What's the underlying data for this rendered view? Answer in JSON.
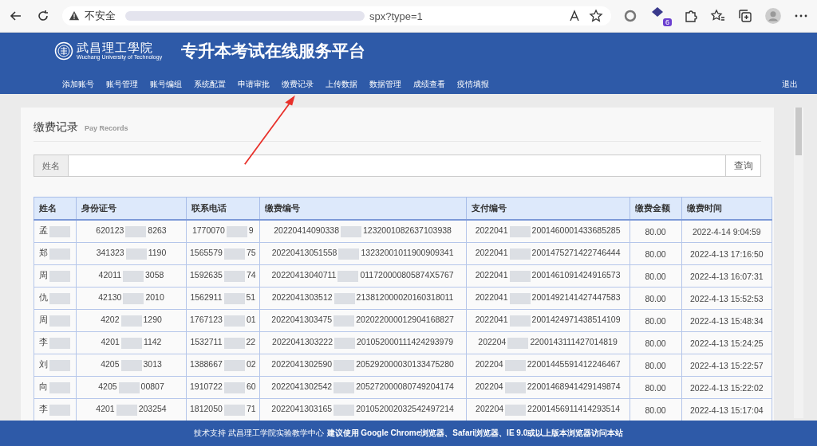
{
  "browser": {
    "security_label": "不安全",
    "url_visible": "spx?type=1",
    "extension_badge": "6"
  },
  "header": {
    "logo_name": "武昌理工學院",
    "logo_english": "Wuchang University of Technology",
    "title": "专升本考试在线服务平台"
  },
  "nav": [
    {
      "label": "添加账号"
    },
    {
      "label": "账号管理"
    },
    {
      "label": "账号编组"
    },
    {
      "label": "系统配置"
    },
    {
      "label": "申请审批"
    },
    {
      "label": "缴费记录"
    },
    {
      "label": "上传数据"
    },
    {
      "label": "数据管理"
    },
    {
      "label": "成绩查看"
    },
    {
      "label": "疫情填报"
    }
  ],
  "logout": "退出",
  "page": {
    "title": "缴费记录",
    "subtitle": "Pay Records"
  },
  "search": {
    "label": "姓名",
    "button": "查询"
  },
  "table": {
    "columns": [
      "姓名",
      "身份证号",
      "联系电话",
      "缴费编号",
      "支付编号",
      "缴费金额",
      "缴费时间"
    ],
    "rows": [
      [
        [
          "孟"
        ],
        [
          "620123",
          "8263"
        ],
        [
          "1770070",
          "9"
        ],
        [
          "20220414090338",
          "1232001082637103938"
        ],
        [
          "2022041",
          "2001460001433685285"
        ],
        "80.00",
        "2022-4-14 9:04:59"
      ],
      [
        [
          "郑"
        ],
        [
          "341323",
          "1190"
        ],
        [
          "1565579",
          "75"
        ],
        [
          "20220413051558",
          "13232001011900909341"
        ],
        [
          "2022041",
          "2001475271422746444"
        ],
        "80.00",
        "2022-4-13 17:16:50"
      ],
      [
        [
          "周"
        ],
        [
          "42011",
          "3058"
        ],
        [
          "1592635",
          "74"
        ],
        [
          "20220413040711",
          "011720000805874X5767"
        ],
        [
          "2022041",
          "2001461091424916573"
        ],
        "80.00",
        "2022-4-13 16:07:31"
      ],
      [
        [
          "仇"
        ],
        [
          "42130",
          "2010"
        ],
        [
          "1562911",
          "51"
        ],
        [
          "2022041303512",
          "213812000020160318011"
        ],
        [
          "2022041",
          "2001492141427447583"
        ],
        "80.00",
        "2022-4-13 15:52:53"
      ],
      [
        [
          "周"
        ],
        [
          "4202",
          "1290"
        ],
        [
          "1767123",
          "01"
        ],
        [
          "2022041303475",
          "202022000012904168827"
        ],
        [
          "2022041",
          "2001424971438514109"
        ],
        "80.00",
        "2022-4-13 15:48:34"
      ],
      [
        [
          "李"
        ],
        [
          "4201",
          "1142"
        ],
        [
          "1532711",
          "22"
        ],
        [
          "2022041303222",
          "201052000111424293979"
        ],
        [
          "202204",
          "2200143111427014819"
        ],
        "80.00",
        "2022-4-13 15:24:25"
      ],
      [
        [
          "刘"
        ],
        [
          "4205",
          "3013"
        ],
        [
          "1388667",
          "02"
        ],
        [
          "2022041302590",
          "205292000030133475280"
        ],
        [
          "202204",
          "22001445591412246467"
        ],
        "80.00",
        "2022-4-13 15:22:57"
      ],
      [
        [
          "向"
        ],
        [
          "4205",
          "00807"
        ],
        [
          "1910722",
          "60"
        ],
        [
          "2022041302542",
          "205272000080749204174"
        ],
        [
          "202204",
          "22001468941429149874"
        ],
        "80.00",
        "2022-4-13 15:22:02"
      ],
      [
        [
          "李"
        ],
        [
          "4201",
          "203254"
        ],
        [
          "1812050",
          "71"
        ],
        [
          "2022041303165",
          "201052002032542497214"
        ],
        [
          "202204",
          "22001456911414293514"
        ],
        "80.00",
        "2022-4-13 15:17:04"
      ]
    ]
  },
  "footer": {
    "prefix": "技术支持 武昌理工学院实验教学中心",
    "notice": "建议使用 Google Chrome浏览器、Safari浏览器、IE 9.0或以上版本浏览器访问本站"
  }
}
